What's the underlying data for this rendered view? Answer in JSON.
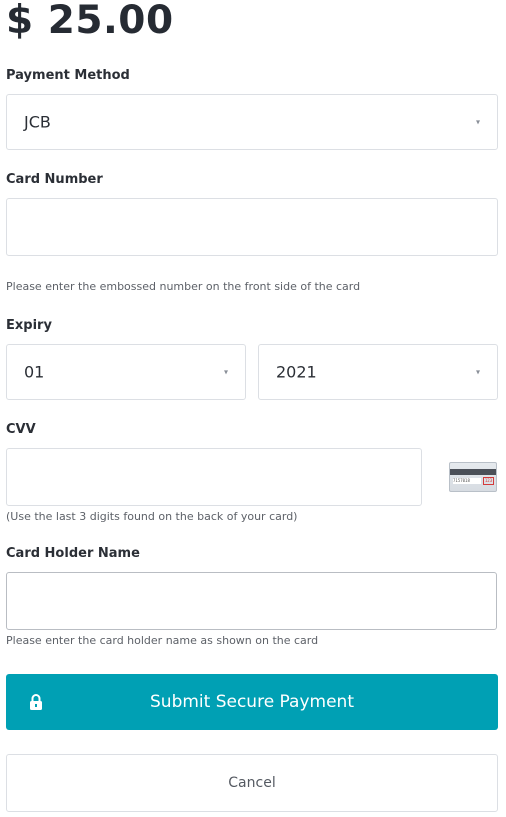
{
  "amount": "$ 25.00",
  "payment_method": {
    "label": "Payment Method",
    "selected": "JCB",
    "caret": "▾"
  },
  "card_number": {
    "label": "Card Number",
    "value": "",
    "hint": "Please enter the embossed number on the front side of the card"
  },
  "expiry": {
    "label": "Expiry",
    "month": "01",
    "year": "2021",
    "caret": "▾"
  },
  "cvv": {
    "label": "CVV",
    "value": "",
    "hint": "(Use the last 3 digits found on the back of your card)",
    "card_icon": {
      "icon": "card-back-icon",
      "signature_text": "7157018",
      "cvv_text": "123"
    }
  },
  "card_holder": {
    "label": "Card Holder Name",
    "value": "",
    "hint": "Please enter the card holder name as shown on the card"
  },
  "submit": {
    "label": "Submit Secure Payment",
    "icon": "lock-icon",
    "color": "#00a0b4"
  },
  "cancel": {
    "label": "Cancel"
  }
}
